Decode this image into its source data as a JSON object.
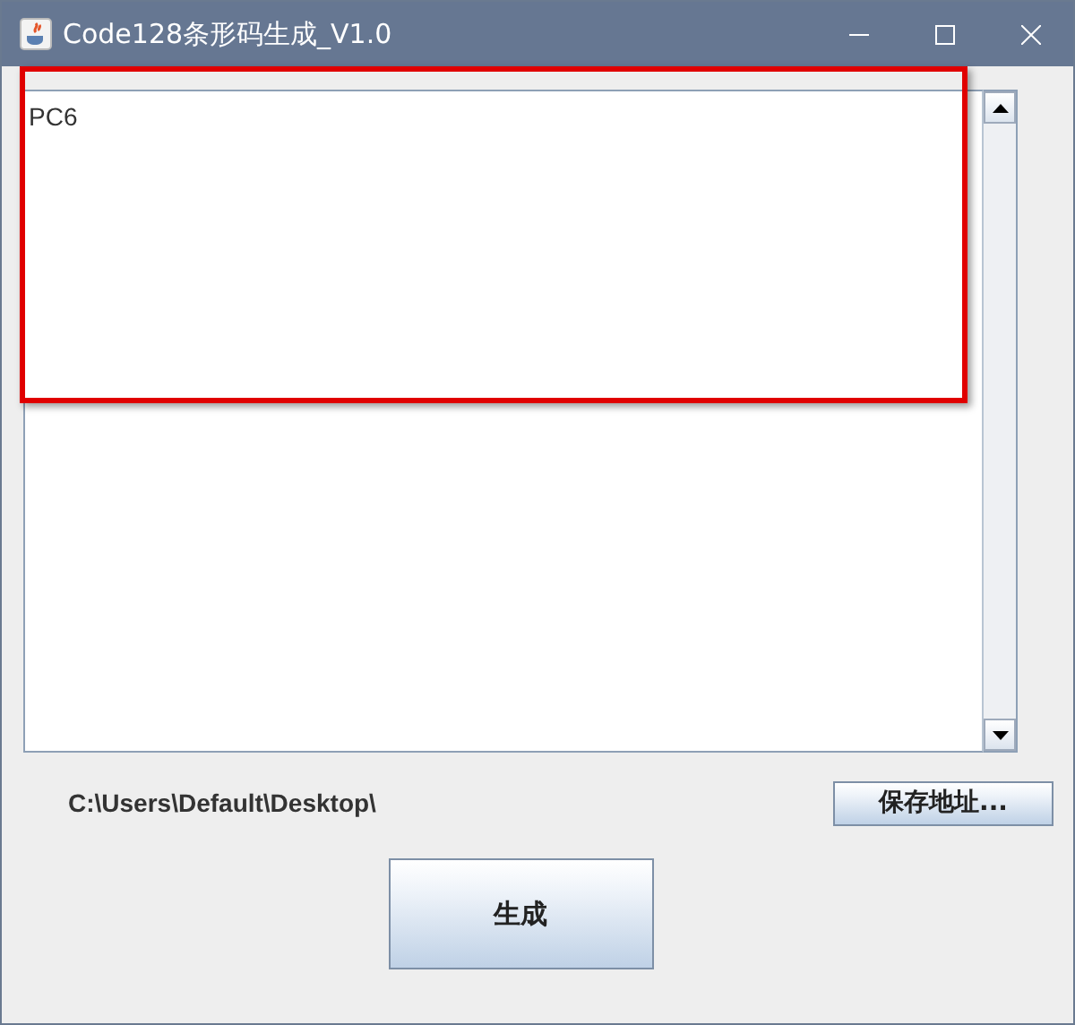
{
  "window": {
    "title": "Code128条形码生成_V1.0"
  },
  "text_area": {
    "value": "PC6"
  },
  "save_path": {
    "label": "C:\\Users\\Default\\Desktop\\"
  },
  "buttons": [
    {
      "label": "保存地址...",
      "kind": "small"
    },
    {
      "label": "生成",
      "kind": "large"
    }
  ],
  "annotation": {
    "kind": "highlight",
    "color": "#e00000"
  }
}
